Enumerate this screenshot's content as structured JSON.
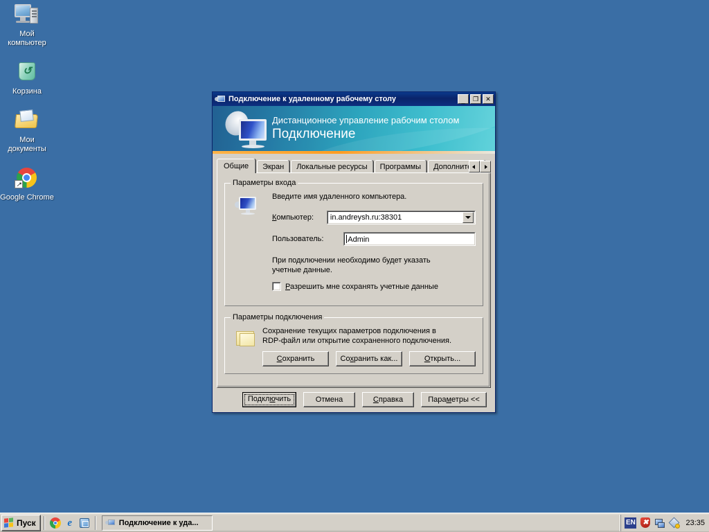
{
  "desktop": {
    "background_color": "#3a6ea5",
    "icons": [
      {
        "label": "Мой компьютер",
        "icon": "my-computer-icon"
      },
      {
        "label": "Корзина",
        "icon": "recycle-bin-icon"
      },
      {
        "label": "Мои документы",
        "icon": "my-documents-icon"
      },
      {
        "label": "Google Chrome",
        "icon": "google-chrome-icon"
      }
    ]
  },
  "dialog": {
    "title": "Подключение к удаленному рабочему столу",
    "title_icon": "remote-desktop-icon",
    "window_buttons": {
      "minimize": "_",
      "maximize": "❐",
      "close": "✕"
    },
    "banner": {
      "line1": "Дистанционное управление рабочим столом",
      "line2": "Подключение",
      "art_icon": "remote-desktop-monitor-art"
    },
    "tabs": [
      {
        "label": "Общие",
        "active": true
      },
      {
        "label": "Экран",
        "active": false
      },
      {
        "label": "Локальные ресурсы",
        "active": false
      },
      {
        "label": "Программы",
        "active": false
      },
      {
        "label": "Дополнительно",
        "active": false
      }
    ],
    "tab_scroll": {
      "left": "◀",
      "right": "▶"
    },
    "login_group": {
      "title": "Параметры входа",
      "icon": "computer-icon",
      "hint": "Введите имя удаленного компьютера.",
      "computer_label": "Компьютер:",
      "computer_value": "in.andreysh.ru:38301",
      "user_label": "Пользователь:",
      "user_value": "Admin",
      "note": "При подключении необходимо будет указать учетные данные.",
      "checkbox_label": "Разрешить мне сохранять учетные данные",
      "checkbox_checked": false
    },
    "connection_group": {
      "title": "Параметры подключения",
      "icon": "folder-icon",
      "hint_line1": "Сохранение текущих параметров подключения в",
      "hint_line2": "RDP-файл или открытие сохраненного подключения.",
      "buttons": [
        {
          "label": "Сохранить"
        },
        {
          "label": "Сохранить как..."
        },
        {
          "label": "Открыть..."
        }
      ]
    },
    "action_buttons": [
      {
        "label": "Подключить",
        "default": true
      },
      {
        "label": "Отмена",
        "default": false
      },
      {
        "label": "Справка",
        "default": false
      },
      {
        "label": "Параметры <<",
        "default": false
      }
    ]
  },
  "taskbar": {
    "start_label": "Пуск",
    "quick_launch": [
      {
        "icon": "google-chrome-icon"
      },
      {
        "icon": "internet-explorer-icon"
      },
      {
        "icon": "show-desktop-icon"
      }
    ],
    "task_buttons": [
      {
        "label": "Подключение к уда...",
        "icon": "remote-desktop-icon"
      }
    ],
    "tray": {
      "language": "EN",
      "icons": [
        {
          "icon": "security-shield-alert-icon"
        },
        {
          "icon": "network-connection-icon"
        },
        {
          "icon": "windows-update-icon"
        }
      ],
      "clock": "23:35"
    }
  }
}
